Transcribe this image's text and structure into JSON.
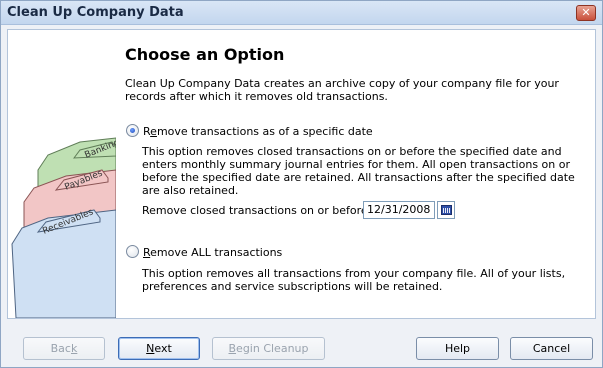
{
  "window": {
    "title": "Clean Up Company Data",
    "close_glyph": "✕"
  },
  "art": {
    "tabs": [
      "Banking",
      "Payables",
      "Receivables"
    ],
    "colors": {
      "banking": "#bfe0b3",
      "payables": "#f2c6c6",
      "receivables": "#cfe0f3"
    }
  },
  "main": {
    "heading": "Choose an Option",
    "intro": "Clean Up Company Data creates an archive copy of your company file for your records after which it removes old transactions.",
    "option_date": {
      "label_pre": "R",
      "label_underlined": "e",
      "label_post": "move transactions as of a specific date",
      "selected": true,
      "description": "This option removes closed transactions on or before the specified date and enters monthly summary journal entries for them.  All open transactions on or before the specified date are retained.  All transactions after the specified date are also retained.",
      "date_label": "Remove closed transactions on or before",
      "date_value": "12/31/2008"
    },
    "option_all": {
      "label_underlined": "R",
      "label_post": "emove ALL transactions",
      "selected": false,
      "description": "This option removes all transactions from your company file.  All of your lists, preferences and service subscriptions will be retained."
    }
  },
  "footer": {
    "back": {
      "pre": "Bac",
      "u": "k",
      "post": ""
    },
    "next": {
      "pre": "",
      "u": "N",
      "post": "ext"
    },
    "begin": {
      "pre": "",
      "u": "B",
      "post": "egin Cleanup"
    },
    "help": "Help",
    "cancel": "Cancel"
  }
}
